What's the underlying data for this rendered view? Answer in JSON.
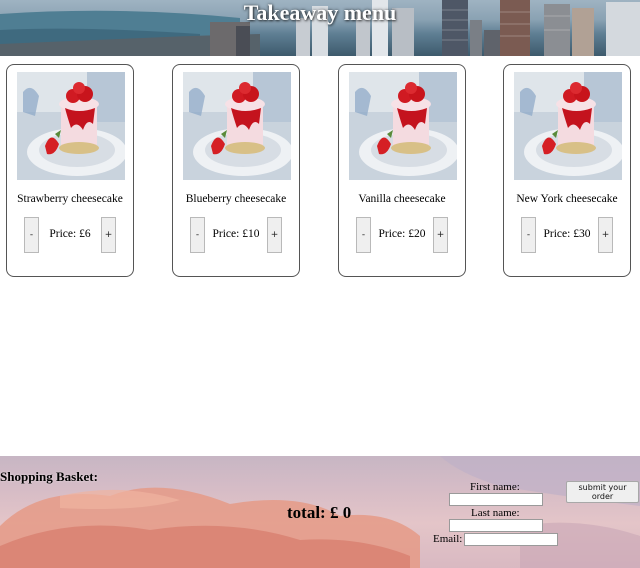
{
  "header": {
    "title": "Takeaway menu"
  },
  "products": [
    {
      "name": "Strawberry cheesecake",
      "price_label": "Price: £6",
      "minus_label": "-",
      "plus_label": "+"
    },
    {
      "name": "Blueberry cheesecake",
      "price_label": "Price: £10",
      "minus_label": "-",
      "plus_label": "+"
    },
    {
      "name": "Vanilla cheesecake",
      "price_label": "Price: £20",
      "minus_label": "-",
      "plus_label": "+"
    },
    {
      "name": "New York cheesecake",
      "price_label": "Price: £30",
      "minus_label": "-",
      "plus_label": "+"
    }
  ],
  "basket": {
    "title": "Shopping Basket:",
    "total_label": "total: £ 0"
  },
  "order_form": {
    "first_name_label": "First name:",
    "first_name_value": "",
    "last_name_label": "Last name:",
    "last_name_value": "",
    "email_label": "Email:",
    "email_value": "",
    "submit_label": "submit your order"
  }
}
